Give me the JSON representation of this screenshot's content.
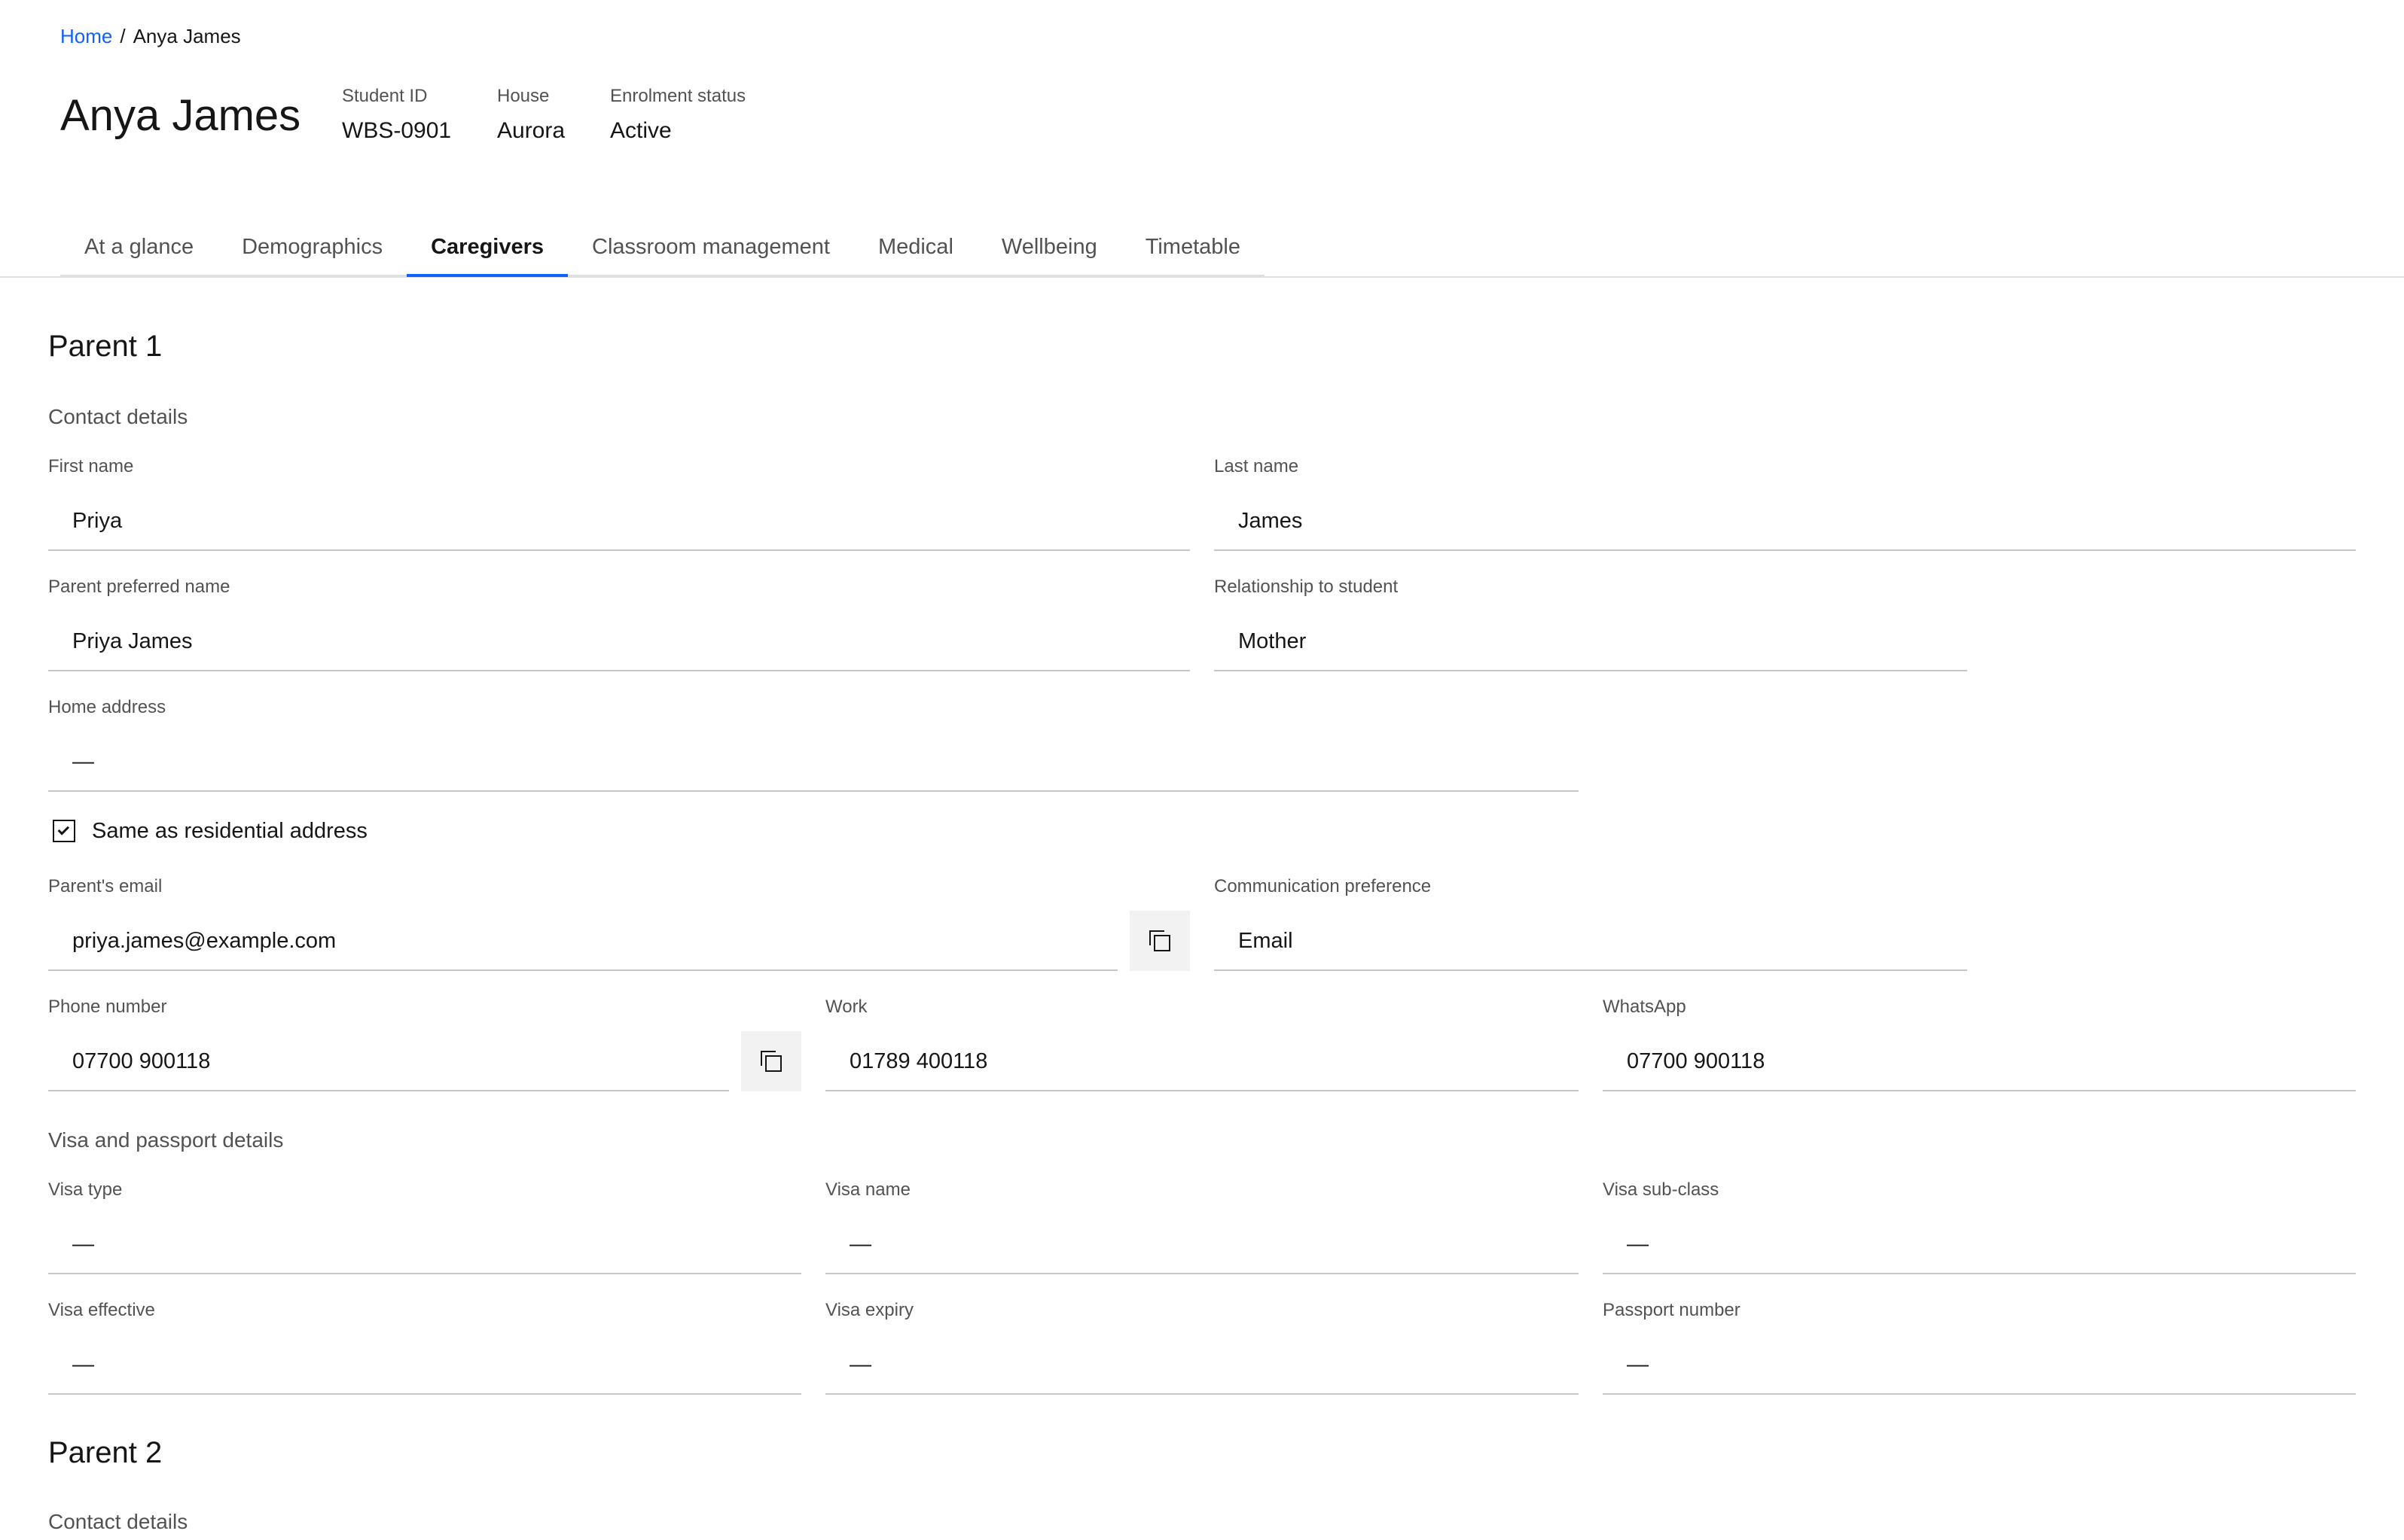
{
  "breadcrumb": {
    "home": "Home",
    "separator": "/",
    "current": "Anya James"
  },
  "header": {
    "name": "Anya James",
    "student_id": {
      "label": "Student ID",
      "value": "WBS-0901"
    },
    "house": {
      "label": "House",
      "value": "Aurora"
    },
    "enrolment": {
      "label": "Enrolment status",
      "value": "Active"
    }
  },
  "tabs": [
    {
      "label": "At a glance"
    },
    {
      "label": "Demographics"
    },
    {
      "label": "Caregivers",
      "active": true
    },
    {
      "label": "Classroom management"
    },
    {
      "label": "Medical"
    },
    {
      "label": "Wellbeing"
    },
    {
      "label": "Timetable"
    }
  ],
  "parent1": {
    "title": "Parent 1",
    "contact_heading": "Contact details",
    "first_name": {
      "label": "First name",
      "value": "Priya"
    },
    "last_name": {
      "label": "Last name",
      "value": "James"
    },
    "preferred_name": {
      "label": "Parent preferred name",
      "value": "Priya James"
    },
    "relationship": {
      "label": "Relationship to student",
      "value": "Mother"
    },
    "home_address": {
      "label": "Home address",
      "value": "—"
    },
    "same_address": {
      "label": "Same as residential address",
      "checked": true
    },
    "email": {
      "label": "Parent's email",
      "value": "priya.james@example.com"
    },
    "comm_pref": {
      "label": "Communication preference",
      "value": "Email"
    },
    "phone": {
      "label": "Phone number",
      "value": "07700 900118"
    },
    "work": {
      "label": "Work",
      "value": "01789 400118"
    },
    "whatsapp": {
      "label": "WhatsApp",
      "value": "07700 900118"
    },
    "visa_heading": "Visa and passport details",
    "visa_type": {
      "label": "Visa type",
      "value": "—"
    },
    "visa_name": {
      "label": "Visa name",
      "value": "—"
    },
    "visa_subclass": {
      "label": "Visa sub-class",
      "value": "—"
    },
    "visa_effective": {
      "label": "Visa effective",
      "value": "—"
    },
    "visa_expiry": {
      "label": "Visa expiry",
      "value": "—"
    },
    "passport": {
      "label": "Passport number",
      "value": "—"
    }
  },
  "parent2": {
    "title": "Parent 2",
    "contact_heading": "Contact details"
  },
  "icons": {
    "copy": "copy-icon",
    "checkbox": "checkmark-icon"
  },
  "colors": {
    "accent": "#0f62fe",
    "text": "#161616",
    "muted": "#525252",
    "rule": "#c6c6c6"
  }
}
